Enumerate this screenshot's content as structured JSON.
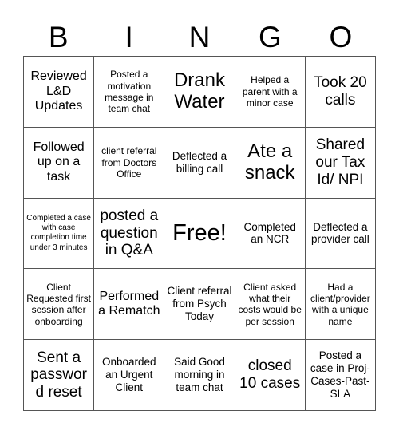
{
  "card": {
    "title": "BINGO",
    "header_letters": [
      "B",
      "I",
      "N",
      "G",
      "O"
    ],
    "grid_size": "5x5",
    "free_space": "Free!",
    "colors": {
      "background": "#ffffff",
      "text": "#000000",
      "grid_line": "#555555"
    },
    "rows": [
      {
        "cells": [
          {
            "text": "Reviewed L&D Updates",
            "size": "l"
          },
          {
            "text": "Posted a motivation message in team chat",
            "size": "s"
          },
          {
            "text": "Drank Water",
            "size": "xxl"
          },
          {
            "text": "Helped a parent with a minor case",
            "size": "s"
          },
          {
            "text": "Took 20 calls",
            "size": "xl"
          }
        ]
      },
      {
        "cells": [
          {
            "text": "Followed up on a task",
            "size": "l"
          },
          {
            "text": "client referral from Doctors Office",
            "size": "s"
          },
          {
            "text": "Deflected a billing call",
            "size": "m"
          },
          {
            "text": "Ate a snack",
            "size": "xxl"
          },
          {
            "text": "Shared our Tax Id/ NPI",
            "size": "xl"
          }
        ]
      },
      {
        "cells": [
          {
            "text": "Completed a case with case completion time under 3 minutes",
            "size": "xs"
          },
          {
            "text": "posted a question in Q&A",
            "size": "xl"
          },
          {
            "text": "Free!",
            "size": "free"
          },
          {
            "text": "Completed an NCR",
            "size": "m"
          },
          {
            "text": "Deflected a provider call",
            "size": "m"
          }
        ]
      },
      {
        "cells": [
          {
            "text": "Client Requested first session after onboarding",
            "size": "s"
          },
          {
            "text": "Performed a Rematch",
            "size": "l"
          },
          {
            "text": "Client referral from Psych Today",
            "size": "m"
          },
          {
            "text": "Client asked what their costs would be per session",
            "size": "s"
          },
          {
            "text": "Had a client/provider with a unique name",
            "size": "s"
          }
        ]
      },
      {
        "cells": [
          {
            "text": "Sent a password reset",
            "size": "xl"
          },
          {
            "text": "Onboarded an Urgent Client",
            "size": "m"
          },
          {
            "text": "Said Good morning in team chat",
            "size": "m"
          },
          {
            "text": "closed 10 cases",
            "size": "xl"
          },
          {
            "text": "Posted a case in Proj-Cases-Past-SLA",
            "size": "m"
          }
        ]
      }
    ]
  }
}
